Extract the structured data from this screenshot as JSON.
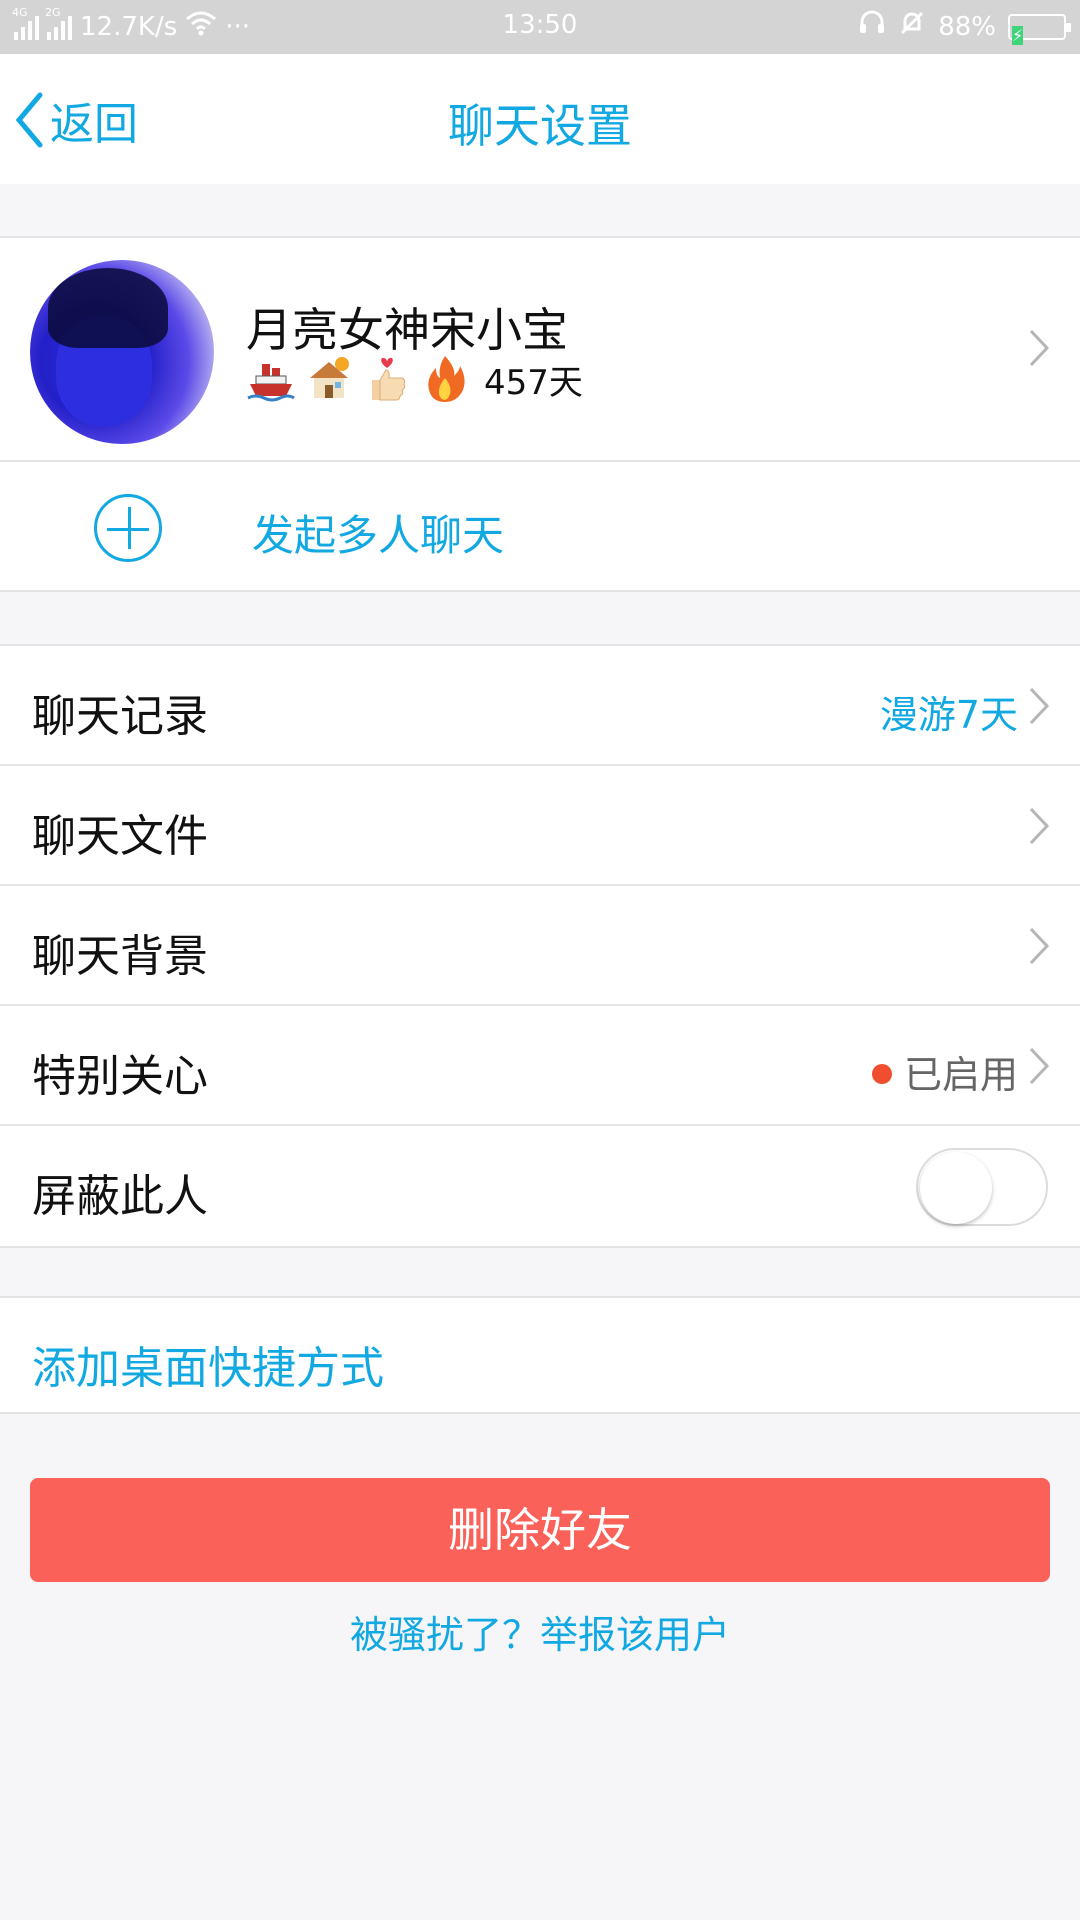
{
  "status_bar": {
    "net1": "4G",
    "net2": "2G",
    "speed": "12.7K/s",
    "more": "···",
    "time": "13:50",
    "battery": "88%",
    "battery_level": 0.88
  },
  "nav": {
    "back_label": "返回",
    "title": "聊天设置"
  },
  "profile": {
    "name": "月亮女神宋小宝",
    "badges": [
      "ship",
      "house",
      "thumbs-up-heart",
      "fire"
    ],
    "days": "457天"
  },
  "group_chat": {
    "label": "发起多人聊天"
  },
  "settings": [
    {
      "label": "聊天记录",
      "value": "漫游7天"
    },
    {
      "label": "聊天文件",
      "value": ""
    },
    {
      "label": "聊天背景",
      "value": ""
    },
    {
      "label": "特别关心",
      "value": "已启用"
    },
    {
      "label": "屏蔽此人",
      "toggle": false
    }
  ],
  "shortcut": {
    "label": "添加桌面快捷方式"
  },
  "actions": {
    "delete_label": "删除好友",
    "report_label": "被骚扰了？举报该用户"
  },
  "colors": {
    "accent": "#12a8e2",
    "danger": "#fa6259",
    "status_dot": "#f04e2e"
  }
}
